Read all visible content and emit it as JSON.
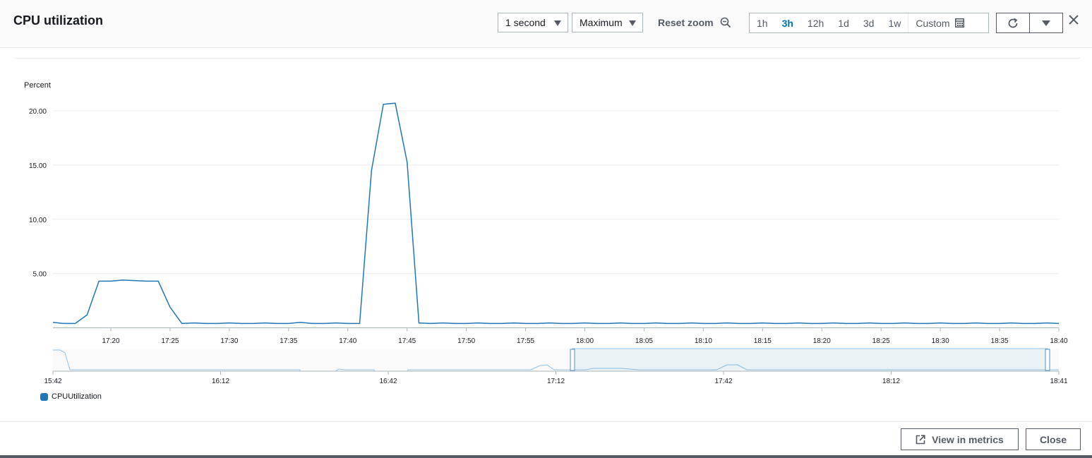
{
  "header": {
    "title": "CPU utilization",
    "period_select": "1 second",
    "statistic_select": "Maximum",
    "reset_zoom": "Reset zoom",
    "time_ranges": [
      "1h",
      "3h",
      "12h",
      "1d",
      "3d",
      "1w"
    ],
    "active_range": "3h",
    "custom_label": "Custom"
  },
  "footer": {
    "view_in_metrics": "View in metrics",
    "close": "Close"
  },
  "legend": {
    "label": "CPUUtilization",
    "color": "#1f77b4"
  },
  "chart_data": [
    {
      "type": "line",
      "ylabel": "Percent",
      "ylim": [
        0,
        20
      ],
      "yticks": [
        "5.00",
        "10.00",
        "15.00",
        "20.00"
      ],
      "xticks": [
        "17:20",
        "17:25",
        "17:30",
        "17:35",
        "17:40",
        "17:45",
        "17:50",
        "17:55",
        "18:00",
        "18:05",
        "18:10",
        "18:15",
        "18:20",
        "18:25",
        "18:30",
        "18:35",
        "18:40"
      ],
      "series": [
        {
          "name": "CPUUtilization",
          "color": "#1f77b4",
          "x_minutes_from_17_20": [
            -5,
            -4,
            -3,
            -2,
            -1,
            0,
            1,
            2,
            3,
            4,
            5,
            6,
            7,
            8,
            9,
            10,
            11,
            12,
            13,
            14,
            15,
            16,
            17,
            18,
            19,
            20,
            21,
            22,
            23,
            24,
            25,
            26,
            27,
            28,
            29,
            30,
            31,
            32,
            33,
            34,
            35,
            36,
            37,
            38,
            39,
            40,
            41,
            42,
            43,
            44,
            45,
            46,
            47,
            48,
            49,
            50,
            51,
            52,
            53,
            54,
            55,
            56,
            57,
            58,
            59,
            60,
            61,
            62,
            63,
            64,
            65,
            66,
            67,
            68,
            69,
            70,
            71,
            72,
            73,
            74,
            75,
            76,
            77,
            78,
            79,
            80
          ],
          "values": [
            0.5,
            0.4,
            0.4,
            1.2,
            4.3,
            4.3,
            4.4,
            4.35,
            4.3,
            4.3,
            1.9,
            0.4,
            0.45,
            0.4,
            0.4,
            0.45,
            0.4,
            0.4,
            0.45,
            0.4,
            0.4,
            0.5,
            0.4,
            0.4,
            0.45,
            0.4,
            0.4,
            14.5,
            20.6,
            20.7,
            15.3,
            0.45,
            0.4,
            0.45,
            0.4,
            0.4,
            0.45,
            0.4,
            0.4,
            0.45,
            0.4,
            0.4,
            0.45,
            0.4,
            0.4,
            0.45,
            0.4,
            0.4,
            0.45,
            0.4,
            0.4,
            0.45,
            0.4,
            0.4,
            0.45,
            0.4,
            0.4,
            0.45,
            0.4,
            0.4,
            0.45,
            0.4,
            0.4,
            0.45,
            0.4,
            0.4,
            0.45,
            0.4,
            0.4,
            0.45,
            0.4,
            0.4,
            0.45,
            0.4,
            0.4,
            0.45,
            0.4,
            0.4,
            0.45,
            0.4,
            0.4,
            0.45,
            0.4,
            0.4,
            0.45,
            0.4
          ]
        }
      ]
    },
    {
      "type": "area",
      "role": "overview-navigator",
      "xticks": [
        "15:42",
        "16:12",
        "16:42",
        "17:12",
        "17:42",
        "18:12",
        "18:41"
      ],
      "selected_range": [
        "17:15",
        "18:41"
      ]
    }
  ]
}
